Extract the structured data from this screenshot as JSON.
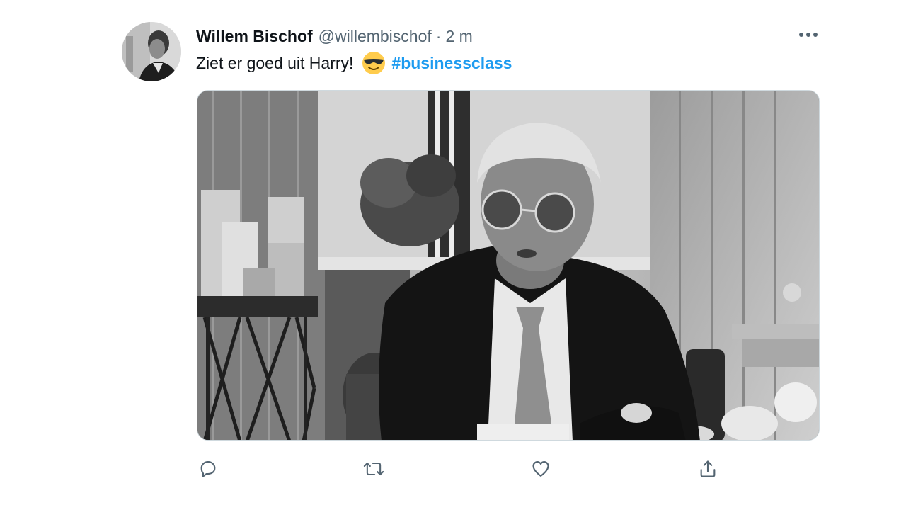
{
  "tweet": {
    "author_name": "Willem Bischof",
    "author_handle": "@willembischof",
    "separator": "·",
    "time": "2 m",
    "text": "Ziet er goed uit Harry!",
    "emoji": "smiling-face-with-sunglasses-emoji",
    "hashtag": "#businessclass"
  },
  "icons": {
    "more": "more-horizontal-icon",
    "reply": "reply-icon",
    "retweet": "retweet-icon",
    "like": "heart-icon",
    "share": "share-icon"
  },
  "colors": {
    "link": "#1d9bf0",
    "secondary_text": "#536471",
    "border": "#cfd9de",
    "primary_text": "#0f1419"
  }
}
